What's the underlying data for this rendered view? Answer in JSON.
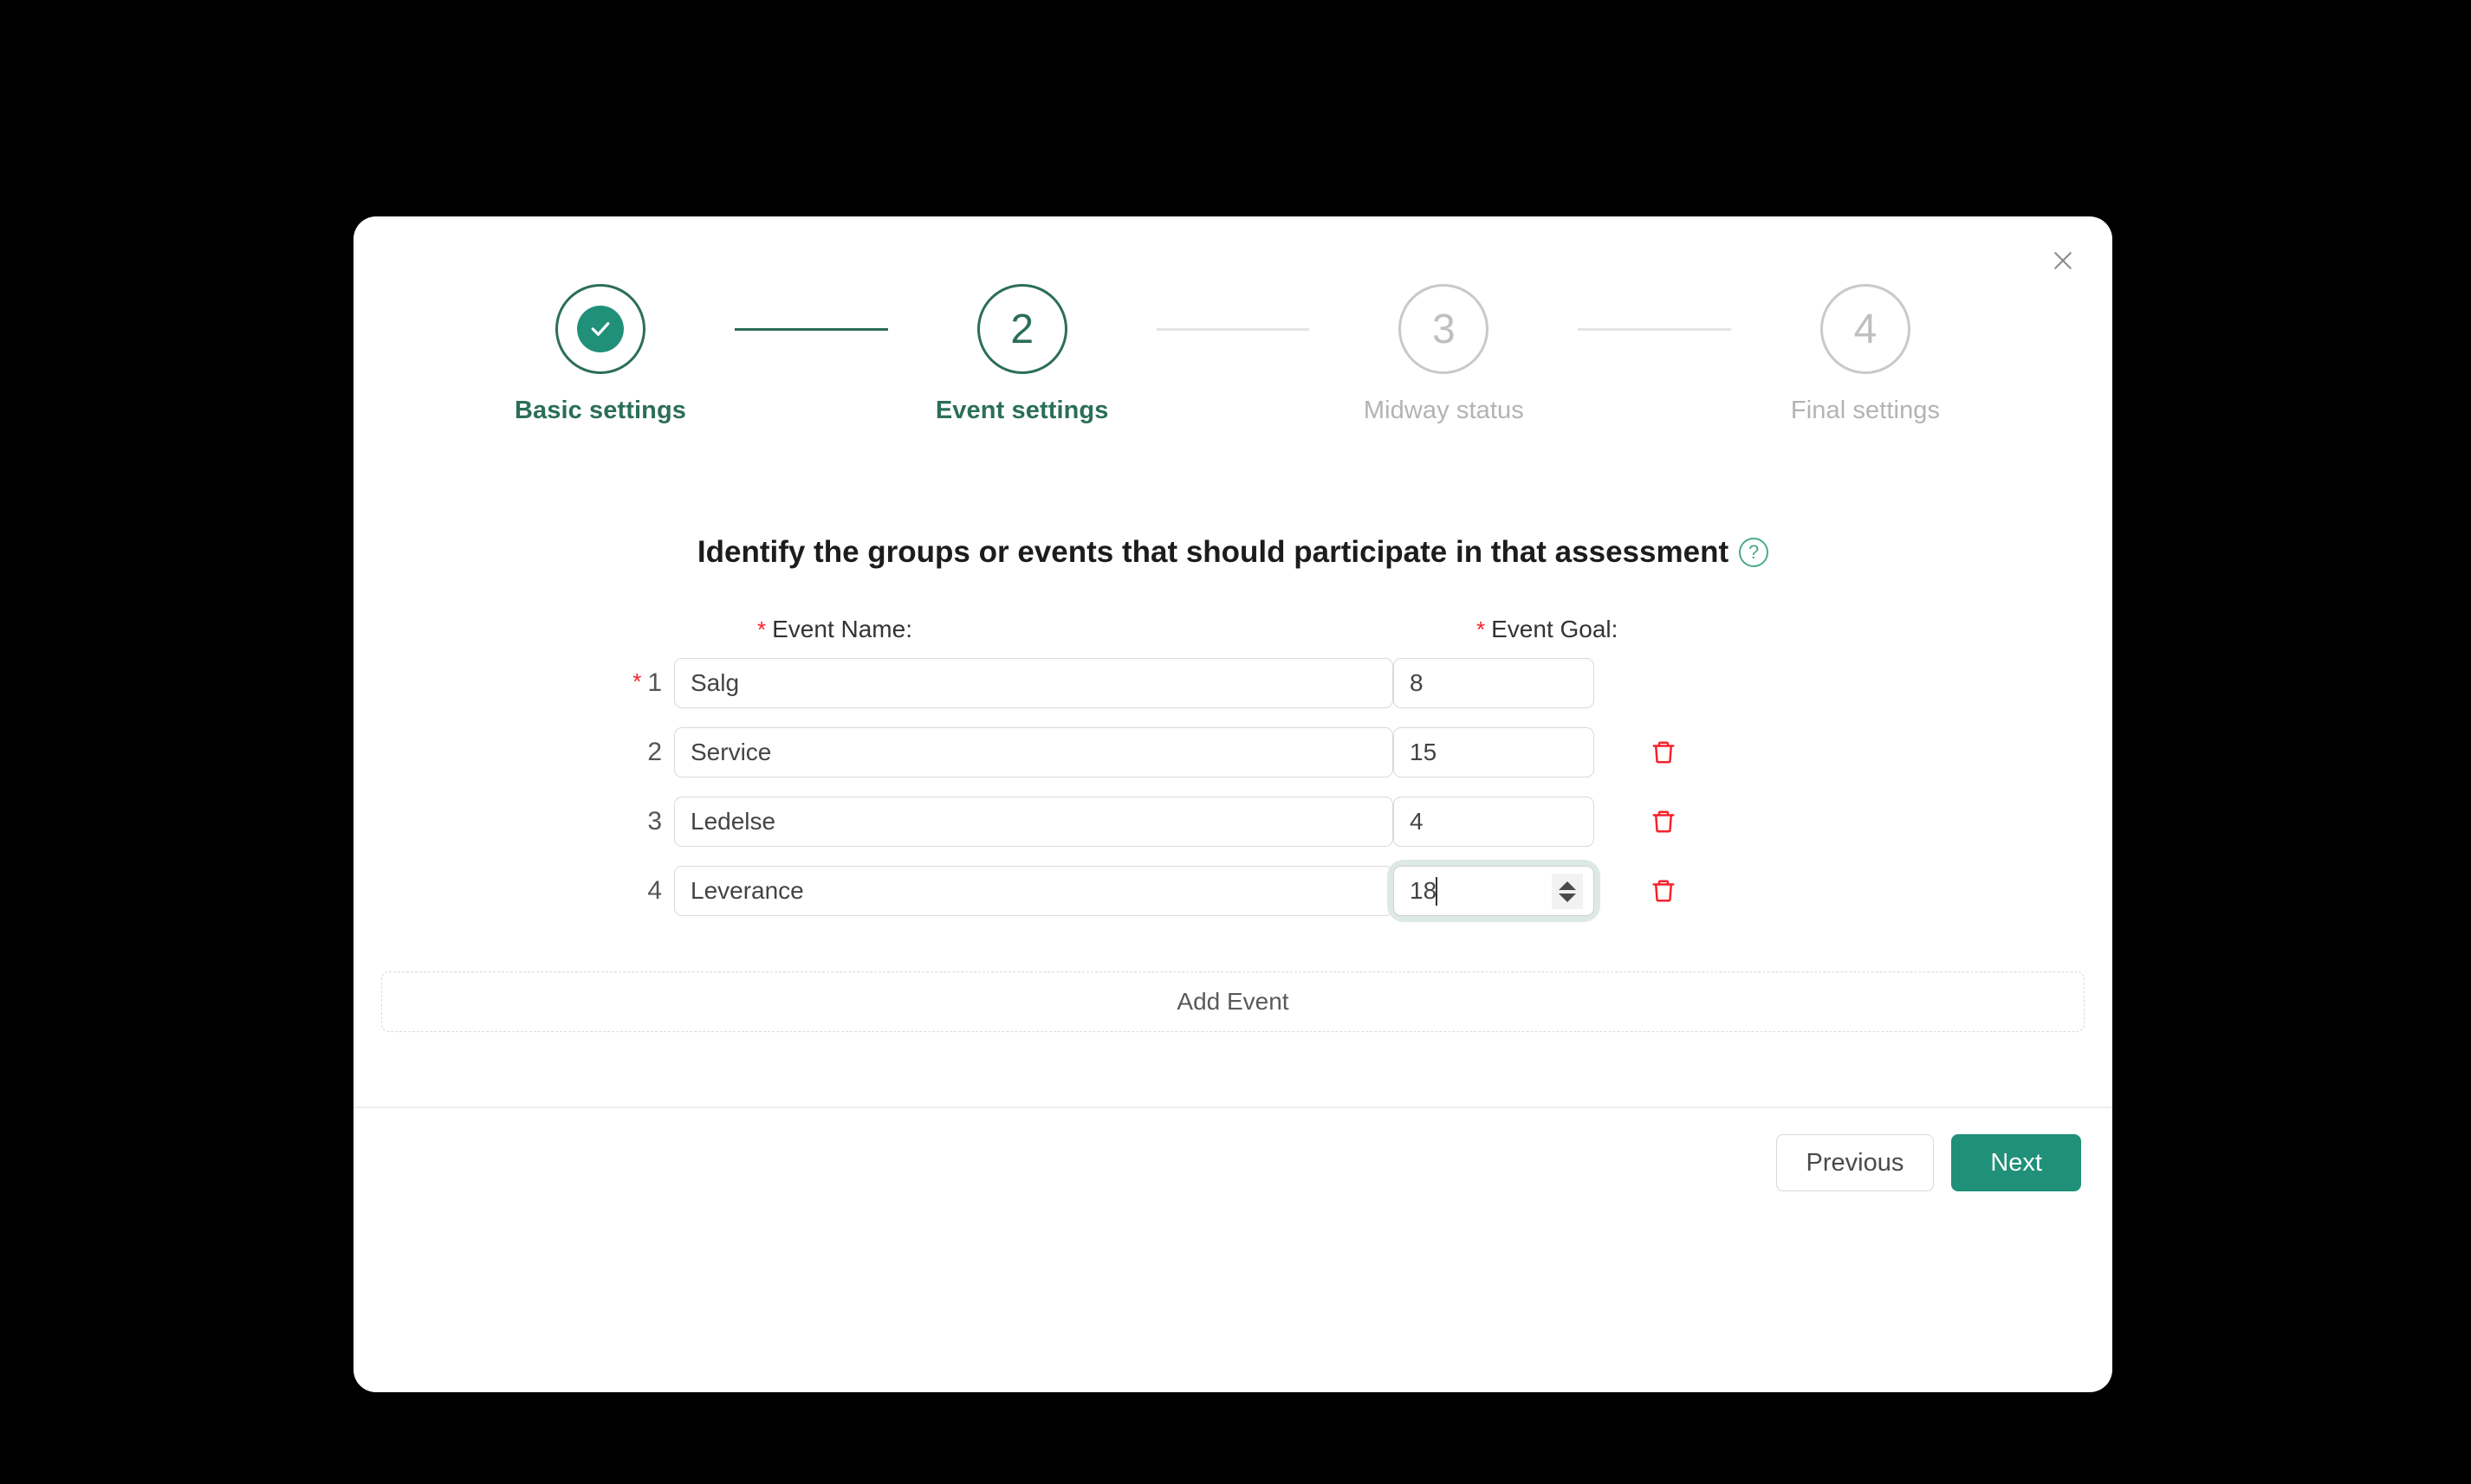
{
  "dialog": {
    "close_icon": "close-icon",
    "heading": "Identify the groups or events that should participate in that assessment",
    "help_icon_glyph": "?"
  },
  "stepper": {
    "steps": [
      {
        "number": "1",
        "label": "Basic settings",
        "state": "done",
        "marker": "check-icon"
      },
      {
        "number": "2",
        "label": "Event settings",
        "state": "current",
        "marker": "2"
      },
      {
        "number": "3",
        "label": "Midway status",
        "state": "upcoming",
        "marker": "3"
      },
      {
        "number": "4",
        "label": "Final settings",
        "state": "upcoming",
        "marker": "4"
      }
    ]
  },
  "form": {
    "name_label": "Event Name",
    "goal_label": "Event Goal",
    "label_colon": ":",
    "required_marker": "*",
    "rows": [
      {
        "index": "1",
        "required": true,
        "name": "Salg",
        "goal": "8",
        "deletable": false,
        "focused": false
      },
      {
        "index": "2",
        "required": false,
        "name": "Service",
        "goal": "15",
        "deletable": true,
        "focused": false
      },
      {
        "index": "3",
        "required": false,
        "name": "Ledelse",
        "goal": "4",
        "deletable": true,
        "focused": false
      },
      {
        "index": "4",
        "required": false,
        "name": "Leverance",
        "goal": "18",
        "deletable": true,
        "focused": true
      }
    ],
    "add_event_label": "Add Event"
  },
  "footer": {
    "previous_label": "Previous",
    "next_label": "Next"
  },
  "colors": {
    "accent_green": "#219078",
    "dark_green": "#2c6e58",
    "danger_red": "#f5222d",
    "border_gray": "#d9d9d9",
    "backdrop": "#000000"
  }
}
